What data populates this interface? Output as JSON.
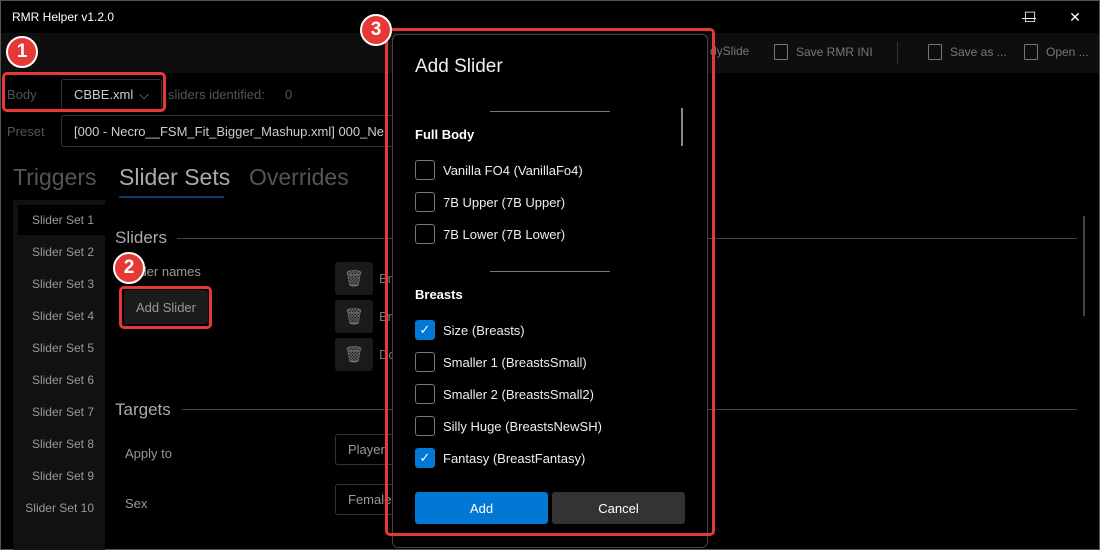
{
  "window": {
    "title": "RMR Helper v1.2.0",
    "minimize": "—",
    "maximize": "☐",
    "close": "✕"
  },
  "toolbar": {
    "bodyslide_partial": "dySlide",
    "save_rmr_ini": "Save RMR INI",
    "save_as": "Save as ...",
    "open": "Open ..."
  },
  "body": {
    "label": "Body",
    "value": "CBBE.xml",
    "sliders_identified_label": "sliders identified:",
    "sliders_identified_count": "0"
  },
  "preset": {
    "label": "Preset",
    "value": "[000 - Necro__FSM_Fit_Bigger_Mashup.xml] 000_Ne"
  },
  "tabs": [
    "Triggers",
    "Slider Sets",
    "Overrides"
  ],
  "slider_sets": [
    "Slider Set 1",
    "Slider Set 2",
    "Slider Set 3",
    "Slider Set 4",
    "Slider Set 5",
    "Slider Set 6",
    "Slider Set 7",
    "Slider Set 8",
    "Slider Set 9",
    "Slider Set 10"
  ],
  "sliders": {
    "heading": "Sliders",
    "names_label": "Slider names",
    "add_button": "Add Slider",
    "rows_partial": [
      "Br",
      "Br",
      "Do"
    ]
  },
  "targets": {
    "heading": "Targets",
    "apply_to_label": "Apply to",
    "apply_to_value": "Player",
    "sex_label": "Sex",
    "sex_value": "Female"
  },
  "dialog": {
    "title": "Add Slider",
    "groups": [
      {
        "name": "Full Body",
        "items": [
          {
            "label": "Vanilla FO4  (VanillaFo4)",
            "checked": false
          },
          {
            "label": "7B Upper  (7B Upper)",
            "checked": false
          },
          {
            "label": "7B Lower  (7B Lower)",
            "checked": false
          }
        ]
      },
      {
        "name": "Breasts",
        "items": [
          {
            "label": "Size  (Breasts)",
            "checked": true
          },
          {
            "label": "Smaller 1  (BreastsSmall)",
            "checked": false
          },
          {
            "label": "Smaller 2  (BreastsSmall2)",
            "checked": false
          },
          {
            "label": "Silly Huge  (BreastsNewSH)",
            "checked": false
          },
          {
            "label": "Fantasy  (BreastFantasy)",
            "checked": true
          }
        ]
      }
    ],
    "add_button": "Add",
    "cancel_button": "Cancel"
  },
  "annotations": [
    "1",
    "2",
    "3"
  ],
  "colors": {
    "accent": "#0078d4",
    "annotation": "#e53935"
  }
}
